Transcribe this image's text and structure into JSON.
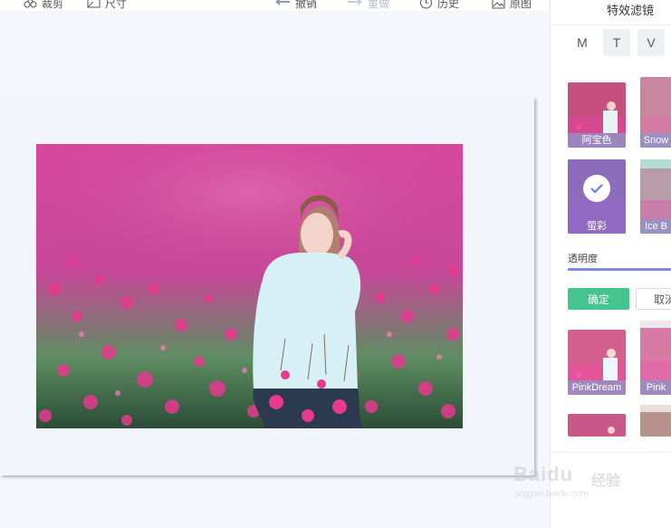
{
  "toolbar": {
    "crop_label": "裁剪",
    "size_label": "尺寸",
    "undo_label": "撤销",
    "redo_label": "重做",
    "history_label": "历史",
    "original_label": "原图"
  },
  "panel": {
    "title": "特效滤镜",
    "tabs": [
      "M",
      "T",
      "V"
    ],
    "active_tabs": [
      "T",
      "V"
    ],
    "filters": [
      {
        "label": "阿宝色",
        "selected": false
      },
      {
        "label": "Snow",
        "selected": false
      },
      {
        "label": "萤彩",
        "selected": true
      },
      {
        "label": "Ice B",
        "selected": false
      },
      {
        "label": "PinkDream",
        "selected": false
      },
      {
        "label": "Pink",
        "selected": false
      }
    ],
    "opacity_label": "透明度",
    "opacity_value": 100,
    "confirm_label": "确定",
    "cancel_label": "取消"
  },
  "watermark": {
    "logo_text": "Baidu",
    "cn_text": "经验",
    "url": "jingyan.baidu.com"
  },
  "colors": {
    "accent": "#7f8be0",
    "confirm": "#45c48f",
    "selected_overlay": "#6e7ddc"
  }
}
